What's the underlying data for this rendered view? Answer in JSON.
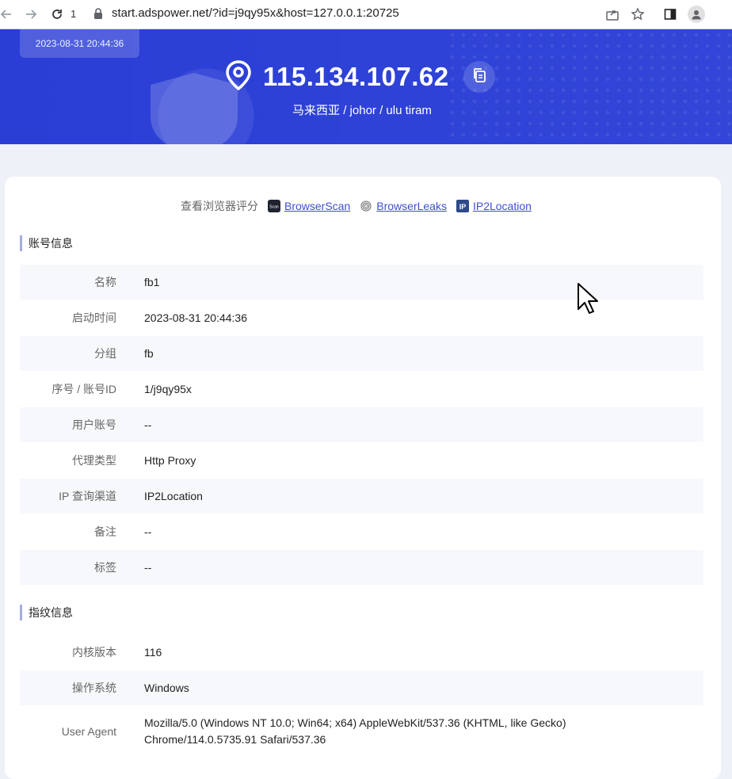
{
  "browser": {
    "tab_count": "1",
    "url": "start.adspower.net/?id=j9qy95x&host=127.0.0.1:20725"
  },
  "hero": {
    "timestamp": "2023-08-31 20:44:36",
    "ip": "115.134.107.62",
    "location": "马来西亚 / johor / ulu tiram"
  },
  "score": {
    "label": "查看浏览器评分",
    "links": [
      "BrowserScan",
      "BrowserLeaks",
      "IP2Location"
    ]
  },
  "account": {
    "title": "账号信息",
    "rows": [
      {
        "key": "名称",
        "value": "fb1"
      },
      {
        "key": "启动时间",
        "value": "2023-08-31 20:44:36"
      },
      {
        "key": "分组",
        "value": "fb"
      },
      {
        "key": "序号 / 账号ID",
        "value": "1/j9qy95x"
      },
      {
        "key": "用户账号",
        "value": "--"
      },
      {
        "key": "代理类型",
        "value": "Http Proxy"
      },
      {
        "key": "IP 查询渠道",
        "value": "IP2Location"
      },
      {
        "key": "备注",
        "value": "--"
      },
      {
        "key": "标签",
        "value": "--"
      }
    ]
  },
  "fingerprint": {
    "title": "指纹信息",
    "rows": [
      {
        "key": "内核版本",
        "value": "116"
      },
      {
        "key": "操作系统",
        "value": "Windows"
      },
      {
        "key": "User Agent",
        "value_line1": "Mozilla/5.0 (Windows NT 10.0; Win64; x64) AppleWebKit/537.36 (KHTML, like Gecko)",
        "value_line2": "Chrome/114.0.5735.91 Safari/537.36"
      }
    ]
  },
  "colors": {
    "hero_bg": "#2a3ed6",
    "link": "#3f4fcf",
    "section_bar": "#a6aede"
  }
}
